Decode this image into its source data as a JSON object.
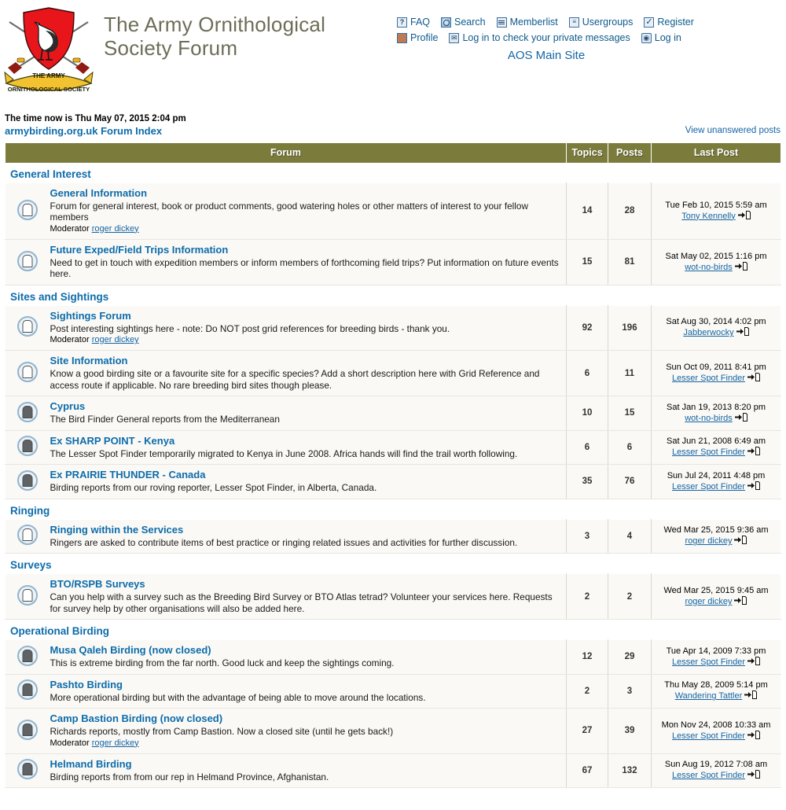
{
  "header": {
    "site_title": "The Army Ornithological Society Forum",
    "logo_alt": "army-ornithological-society-crest",
    "main_site_link": "AOS Main Site",
    "nav_row1": [
      {
        "label": "FAQ",
        "icon": "faq-icon"
      },
      {
        "label": "Search",
        "icon": "search-icon"
      },
      {
        "label": "Memberlist",
        "icon": "memberlist-icon"
      },
      {
        "label": "Usergroups",
        "icon": "usergroups-icon"
      },
      {
        "label": "Register",
        "icon": "register-icon"
      }
    ],
    "nav_row2": [
      {
        "label": "Profile",
        "icon": "profile-icon"
      },
      {
        "label": "Log in to check your private messages",
        "icon": "private-messages-icon"
      },
      {
        "label": "Log in",
        "icon": "login-icon"
      }
    ]
  },
  "info": {
    "time_now": "The time now is Thu May 07, 2015 2:04 pm",
    "forum_index": "armybirding.org.uk Forum Index",
    "view_unanswered": "View unanswered posts"
  },
  "table": {
    "columns": {
      "forum": "Forum",
      "topics": "Topics",
      "posts": "Posts",
      "last_post": "Last Post"
    }
  },
  "colors": {
    "header_bar": "#7b7c3c",
    "link_blue": "#0d6cab",
    "row_bg": "#faf9f5",
    "category_blue": "#0d6cab"
  },
  "categories": [
    {
      "name": "General Interest",
      "forums": [
        {
          "icon": "forum-folder-open-icon",
          "locked": false,
          "title": "General Information",
          "description": "Forum for general interest, book or product comments, good watering holes or other matters of interest to your fellow members",
          "moderator_label": "Moderator",
          "moderator": "roger dickey",
          "topics": "14",
          "posts": "28",
          "last_post_date": "Tue Feb 10, 2015 5:59 am",
          "last_post_user": "Tony Kennelly"
        },
        {
          "icon": "forum-folder-open-icon",
          "locked": false,
          "title": "Future Exped/Field Trips Information",
          "description": "Need to get in touch with expedition members or inform members of forthcoming field trips? Put information on future events here.",
          "moderator_label": "",
          "moderator": "",
          "topics": "15",
          "posts": "81",
          "last_post_date": "Sat May 02, 2015 1:16 pm",
          "last_post_user": "wot-no-birds"
        }
      ]
    },
    {
      "name": "Sites and Sightings",
      "forums": [
        {
          "icon": "forum-folder-open-icon",
          "locked": false,
          "title": "Sightings Forum",
          "description": "Post interesting sightings here - note: Do NOT post grid references for breeding birds - thank you.",
          "moderator_label": "Moderator",
          "moderator": "roger dickey",
          "topics": "92",
          "posts": "196",
          "last_post_date": "Sat Aug 30, 2014 4:02 pm",
          "last_post_user": "Jabberwocky"
        },
        {
          "icon": "forum-folder-open-icon",
          "locked": false,
          "title": "Site Information",
          "description": "Know a good birding site or a favourite site for a specific species? Add a short description here with Grid Reference and access route if applicable. No rare breeding bird sites though please.",
          "moderator_label": "",
          "moderator": "",
          "topics": "6",
          "posts": "11",
          "last_post_date": "Sun Oct 09, 2011 8:41 pm",
          "last_post_user": "Lesser Spot Finder"
        },
        {
          "icon": "forum-folder-locked-icon",
          "locked": true,
          "title": "Cyprus",
          "description": "The Bird Finder General reports from the Mediterranean",
          "moderator_label": "",
          "moderator": "",
          "topics": "10",
          "posts": "15",
          "last_post_date": "Sat Jan 19, 2013 8:20 pm",
          "last_post_user": "wot-no-birds"
        },
        {
          "icon": "forum-folder-locked-icon",
          "locked": true,
          "title": "Ex SHARP POINT - Kenya",
          "description": "The Lesser Spot Finder temporarily migrated to Kenya in June 2008. Africa hands will find the trail worth following.",
          "moderator_label": "",
          "moderator": "",
          "topics": "6",
          "posts": "6",
          "last_post_date": "Sat Jun 21, 2008 6:49 am",
          "last_post_user": "Lesser Spot Finder"
        },
        {
          "icon": "forum-folder-locked-icon",
          "locked": true,
          "title": "Ex PRAIRIE THUNDER - Canada",
          "description": "Birding reports from our roving reporter, Lesser Spot Finder, in Alberta, Canada.",
          "moderator_label": "",
          "moderator": "",
          "topics": "35",
          "posts": "76",
          "last_post_date": "Sun Jul 24, 2011 4:48 pm",
          "last_post_user": "Lesser Spot Finder"
        }
      ]
    },
    {
      "name": "Ringing",
      "forums": [
        {
          "icon": "forum-folder-open-icon",
          "locked": false,
          "title": "Ringing within the Services",
          "description": "Ringers are asked to contribute items of best practice or ringing related issues and activities for further discussion.",
          "moderator_label": "",
          "moderator": "",
          "topics": "3",
          "posts": "4",
          "last_post_date": "Wed Mar 25, 2015 9:36 am",
          "last_post_user": "roger dickey"
        }
      ]
    },
    {
      "name": "Surveys",
      "forums": [
        {
          "icon": "forum-folder-open-icon",
          "locked": false,
          "title": "BTO/RSPB Surveys",
          "description": "Can you help with a survey such as the Breeding Bird Survey or BTO Atlas tetrad? Volunteer your services here. Requests for survey help by other organisations will also be added here.",
          "moderator_label": "",
          "moderator": "",
          "topics": "2",
          "posts": "2",
          "last_post_date": "Wed Mar 25, 2015 9:45 am",
          "last_post_user": "roger dickey"
        }
      ]
    },
    {
      "name": "Operational Birding",
      "forums": [
        {
          "icon": "forum-folder-locked-icon",
          "locked": true,
          "title": "Musa Qaleh Birding (now closed)",
          "description": "This is extreme birding from the far north. Good luck and keep the sightings coming.",
          "moderator_label": "",
          "moderator": "",
          "topics": "12",
          "posts": "29",
          "last_post_date": "Tue Apr 14, 2009 7:33 pm",
          "last_post_user": "Lesser Spot Finder"
        },
        {
          "icon": "forum-folder-locked-icon",
          "locked": true,
          "title": "Pashto Birding",
          "description": "More operational birding but with the advantage of being able to move around the locations.",
          "moderator_label": "",
          "moderator": "",
          "topics": "2",
          "posts": "3",
          "last_post_date": "Thu May 28, 2009 5:14 pm",
          "last_post_user": "Wandering Tattler"
        },
        {
          "icon": "forum-folder-locked-icon",
          "locked": true,
          "title": "Camp Bastion Birding (now closed)",
          "description": "Richards reports, mostly from Camp Bastion. Now a closed site (until he gets back!)",
          "moderator_label": "Moderator",
          "moderator": "roger dickey",
          "topics": "27",
          "posts": "39",
          "last_post_date": "Mon Nov 24, 2008 10:33 am",
          "last_post_user": "Lesser Spot Finder"
        },
        {
          "icon": "forum-folder-locked-icon",
          "locked": true,
          "title": "Helmand Birding",
          "description": "Birding reports from from our rep in Helmand Province, Afghanistan.",
          "moderator_label": "",
          "moderator": "",
          "topics": "67",
          "posts": "132",
          "last_post_date": "Sun Aug 19, 2012 7:08 am",
          "last_post_user": "Lesser Spot Finder"
        }
      ]
    }
  ]
}
